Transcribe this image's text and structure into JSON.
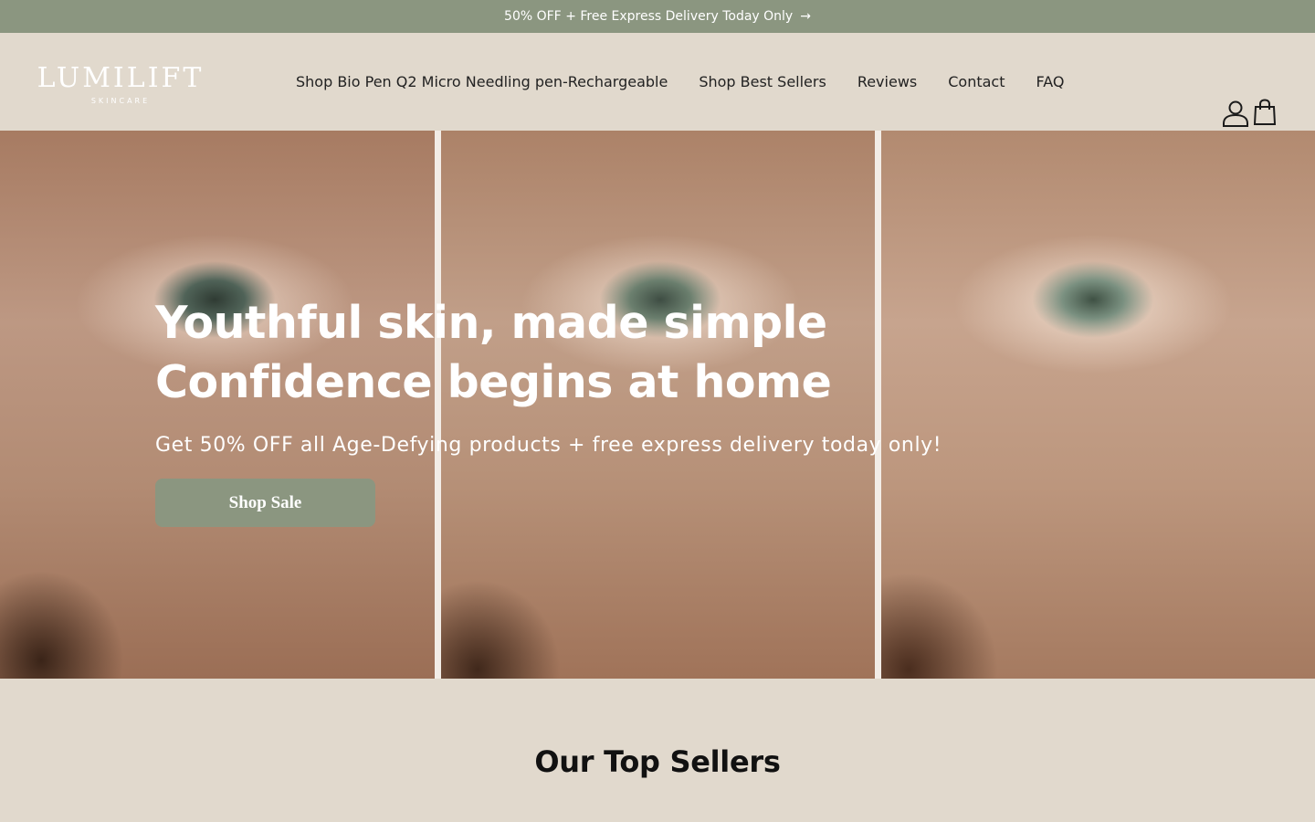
{
  "announcement": {
    "text": "50% OFF + Free Express Delivery Today Only",
    "arrow": "→"
  },
  "logo": {
    "wordmark": "LUMILIFT",
    "sub": "SKINCARE"
  },
  "nav": {
    "items": [
      {
        "label": "Shop Bio Pen Q2 Micro Needling pen-Rechargeable"
      },
      {
        "label": "Shop Best Sellers"
      },
      {
        "label": "Reviews"
      },
      {
        "label": "Contact"
      },
      {
        "label": "FAQ"
      }
    ]
  },
  "header_icons": [
    "account-icon",
    "cart-icon"
  ],
  "hero": {
    "title_line1": "Youthful skin, made simple",
    "title_line2": "Confidence begins at home",
    "subtitle": "Get 50% OFF all Age-Defying products + free express delivery today only!",
    "button_label": "Shop Sale"
  },
  "section": {
    "title": "Our Top Sellers"
  },
  "colors": {
    "announcement_bg": "#8b9680",
    "page_bg": "#e1d9cd",
    "button_bg": "#8b9680"
  }
}
